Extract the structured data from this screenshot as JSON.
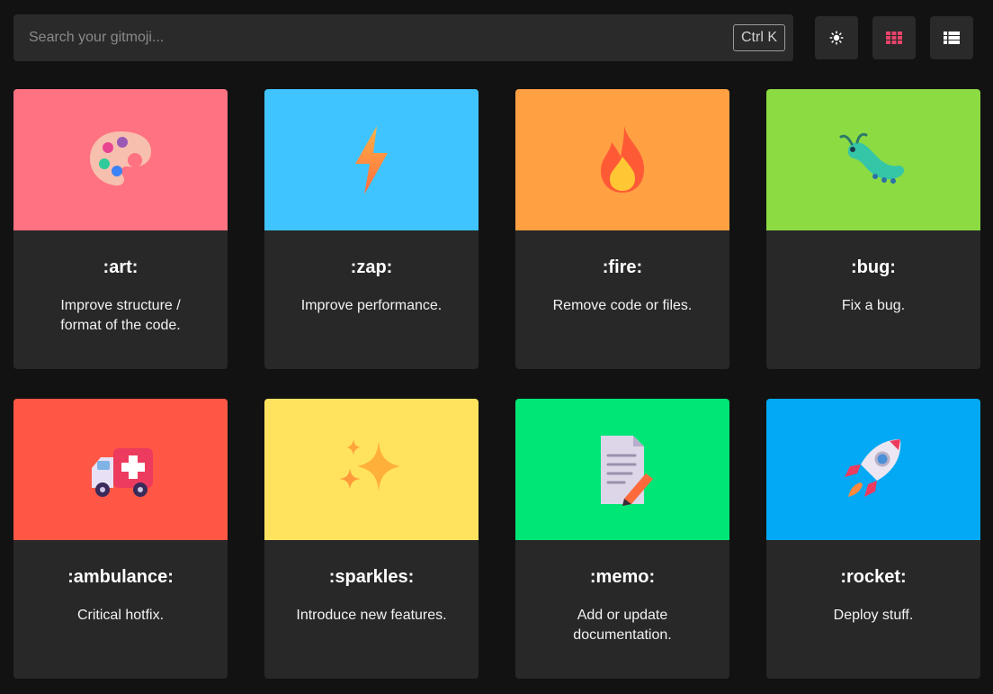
{
  "search": {
    "placeholder": "Search your gitmoji...",
    "shortcut": "Ctrl K"
  },
  "toolbar": {
    "theme_icon": "sun-icon",
    "grid_icon": "grid-icon",
    "list_icon": "list-icon",
    "grid_active_color": "#e8436b"
  },
  "cards": [
    {
      "code": ":art:",
      "description": "Improve structure / format of the code.",
      "color": "#ff7281",
      "icon": "palette-icon"
    },
    {
      "code": ":zap:",
      "description": "Improve performance.",
      "color": "#40c4ff",
      "icon": "lightning-icon"
    },
    {
      "code": ":fire:",
      "description": "Remove code or files.",
      "color": "#ffa043",
      "icon": "fire-icon"
    },
    {
      "code": ":bug:",
      "description": "Fix a bug.",
      "color": "#8cdb42",
      "icon": "bug-icon"
    },
    {
      "code": ":ambulance:",
      "description": "Critical hotfix.",
      "color": "#ff5745",
      "icon": "ambulance-icon"
    },
    {
      "code": ":sparkles:",
      "description": "Introduce new features.",
      "color": "#ffe35f",
      "icon": "sparkles-icon"
    },
    {
      "code": ":memo:",
      "description": "Add or update documentation.",
      "color": "#00e676",
      "icon": "memo-icon"
    },
    {
      "code": ":rocket:",
      "description": "Deploy stuff.",
      "color": "#03a9f4",
      "icon": "rocket-icon"
    }
  ]
}
